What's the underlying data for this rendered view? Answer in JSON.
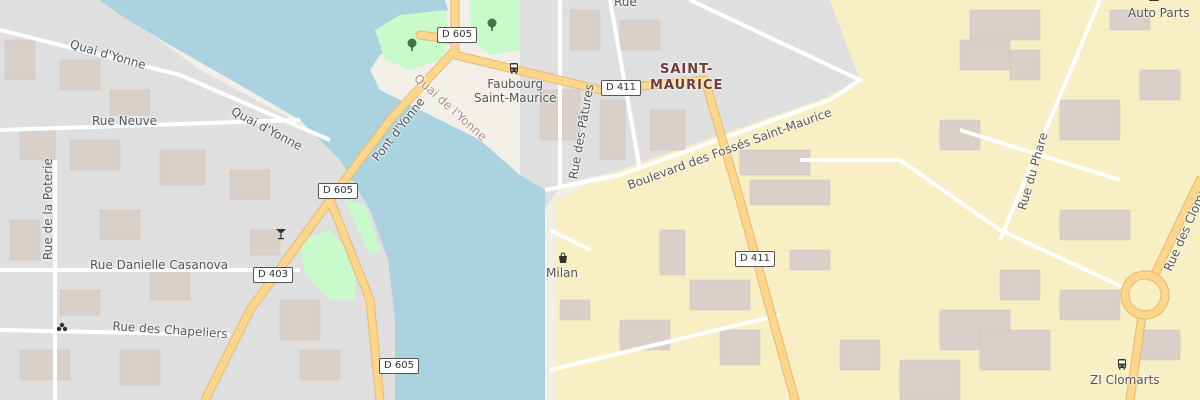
{
  "map": {
    "districts": [
      "SAINT-",
      "MAURICE"
    ],
    "streets": {
      "quai_yonne_1": "Quai d'Yonne",
      "quai_yonne_2": "Quai d'Yonne",
      "rue_neuve": "Rue Neuve",
      "rue_poterie": "Rue de la Poterie",
      "rue_casanova": "Rue Danielle Casanova",
      "rue_chapeliers": "Rue des Chapeliers",
      "pont_yonne": "Pont d'Yonne",
      "quai_de_yonne": "Quai de l'Yonne",
      "rue_patures": "Rue des Pâtures",
      "bd_fosses": "Boulevard des Fossés Saint-Maurice",
      "rue_phare": "Rue du Phare",
      "rue_clomarts": "Rue des Clomarts",
      "rue_top": "Rue"
    },
    "shields": {
      "d605_top": "D 605",
      "d605_mid": "D 605",
      "d605_bottom": "D 605",
      "d411_top": "D 411",
      "d411_mid": "D 411",
      "d403": "D 403"
    },
    "pois": {
      "faubourg": [
        "Faubourg",
        "Saint-Maurice"
      ],
      "milan": "Milan",
      "auto_parts": "Auto Parts",
      "zi_clomarts": "ZI Clomarts"
    },
    "icons": {
      "bus_stop": "bus-stop-icon",
      "shop": "shop-icon",
      "bar": "bar-icon",
      "park": "tree-icon",
      "car": "car-icon"
    },
    "colors": {
      "water": "#aad3df",
      "land": "#f2efe9",
      "residential": "#e0dfdf",
      "industrial": "#f8efc4",
      "park": "#c8facc",
      "road_major": "#fcd68a",
      "building": "#d9d0c9",
      "district_label": "#6e3b3b"
    }
  }
}
